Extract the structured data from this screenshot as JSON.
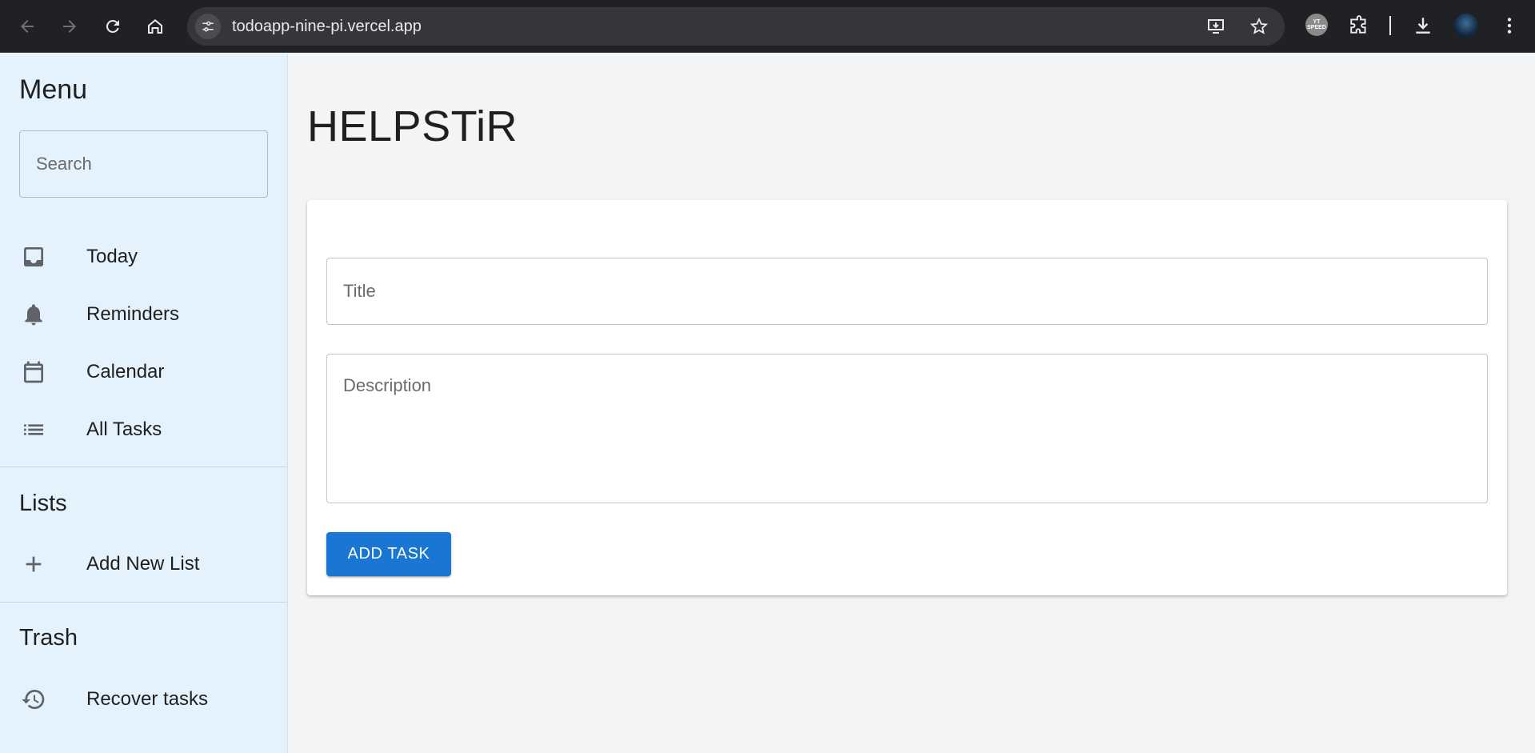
{
  "browser": {
    "url": "todoapp-nine-pi.vercel.app",
    "extension_badge": "YT SPEED"
  },
  "sidebar": {
    "menu_heading": "Menu",
    "search_placeholder": "Search",
    "items": [
      {
        "label": "Today",
        "icon": "inbox-icon"
      },
      {
        "label": "Reminders",
        "icon": "bell-icon"
      },
      {
        "label": "Calendar",
        "icon": "calendar-icon"
      },
      {
        "label": "All Tasks",
        "icon": "list-icon"
      }
    ],
    "lists_heading": "Lists",
    "add_list_label": "Add New List",
    "trash_heading": "Trash",
    "recover_label": "Recover tasks"
  },
  "main": {
    "app_title": "HELPSTiR",
    "title_placeholder": "Title",
    "description_placeholder": "Description",
    "add_task_label": "ADD TASK"
  },
  "colors": {
    "sidebar_bg": "#e3f2fd",
    "page_bg": "#f3f4f6",
    "primary": "#1976d2",
    "chrome_bg": "#202124"
  }
}
